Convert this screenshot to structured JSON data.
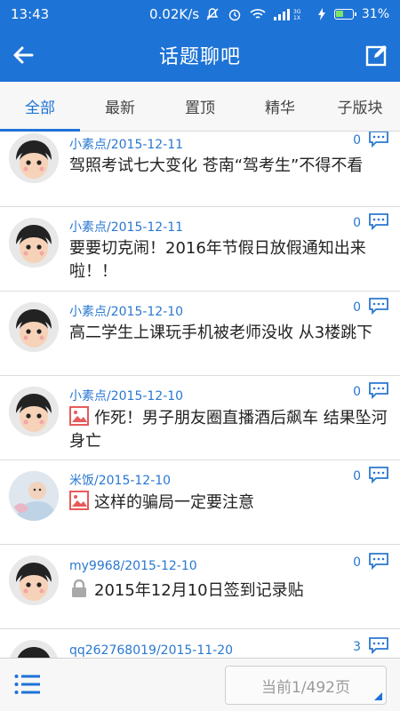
{
  "status_bar": {
    "time": "13:43",
    "network_speed": "0.02K/s",
    "signal_label": "3G 1X",
    "battery": "31%"
  },
  "header": {
    "title": "话题聊吧",
    "back_icon": "back-arrow-icon",
    "edit_icon": "compose-icon"
  },
  "tabs": [
    {
      "label": "全部",
      "active": true
    },
    {
      "label": "最新",
      "active": false
    },
    {
      "label": "置顶",
      "active": false
    },
    {
      "label": "精华",
      "active": false
    },
    {
      "label": "子版块",
      "active": false
    }
  ],
  "posts": [
    {
      "author_date": "小素点/2015-12-11",
      "replies": "0",
      "title": "驾照考试七大变化 苍南“驾考生”不得不看",
      "icon": null,
      "avatar": "cartoon-girl"
    },
    {
      "author_date": "小素点/2015-12-11",
      "replies": "0",
      "title": "要要切克闹！2016年节假日放假通知出来啦！！",
      "icon": null,
      "avatar": "cartoon-girl"
    },
    {
      "author_date": "小素点/2015-12-10",
      "replies": "0",
      "title": "高二学生上课玩手机被老师没收 从3楼跳下",
      "icon": null,
      "avatar": "cartoon-girl"
    },
    {
      "author_date": "小素点/2015-12-10",
      "replies": "0",
      "title": "作死！男子朋友圈直播酒后飙车 结果坠河身亡",
      "icon": "image-icon",
      "avatar": "cartoon-girl"
    },
    {
      "author_date": "米饭/2015-12-10",
      "replies": "0",
      "title": "这样的骗局一定要注意",
      "icon": "image-icon",
      "avatar": "baby-photo"
    },
    {
      "author_date": "my9968/2015-12-10",
      "replies": "0",
      "title": "2015年12月10日签到记录贴",
      "icon": "lock-icon",
      "avatar": "cartoon-girl"
    },
    {
      "author_date": "qq262768019/2015-11-20",
      "replies": "3",
      "title": "",
      "icon": null,
      "avatar": "cartoon-girl"
    }
  ],
  "footer": {
    "menu_icon": "list-menu-icon",
    "page_label": "当前1/492页"
  },
  "colors": {
    "primary": "#1e73d6",
    "link": "#2a78d0",
    "image_badge": "#e85a5a"
  }
}
